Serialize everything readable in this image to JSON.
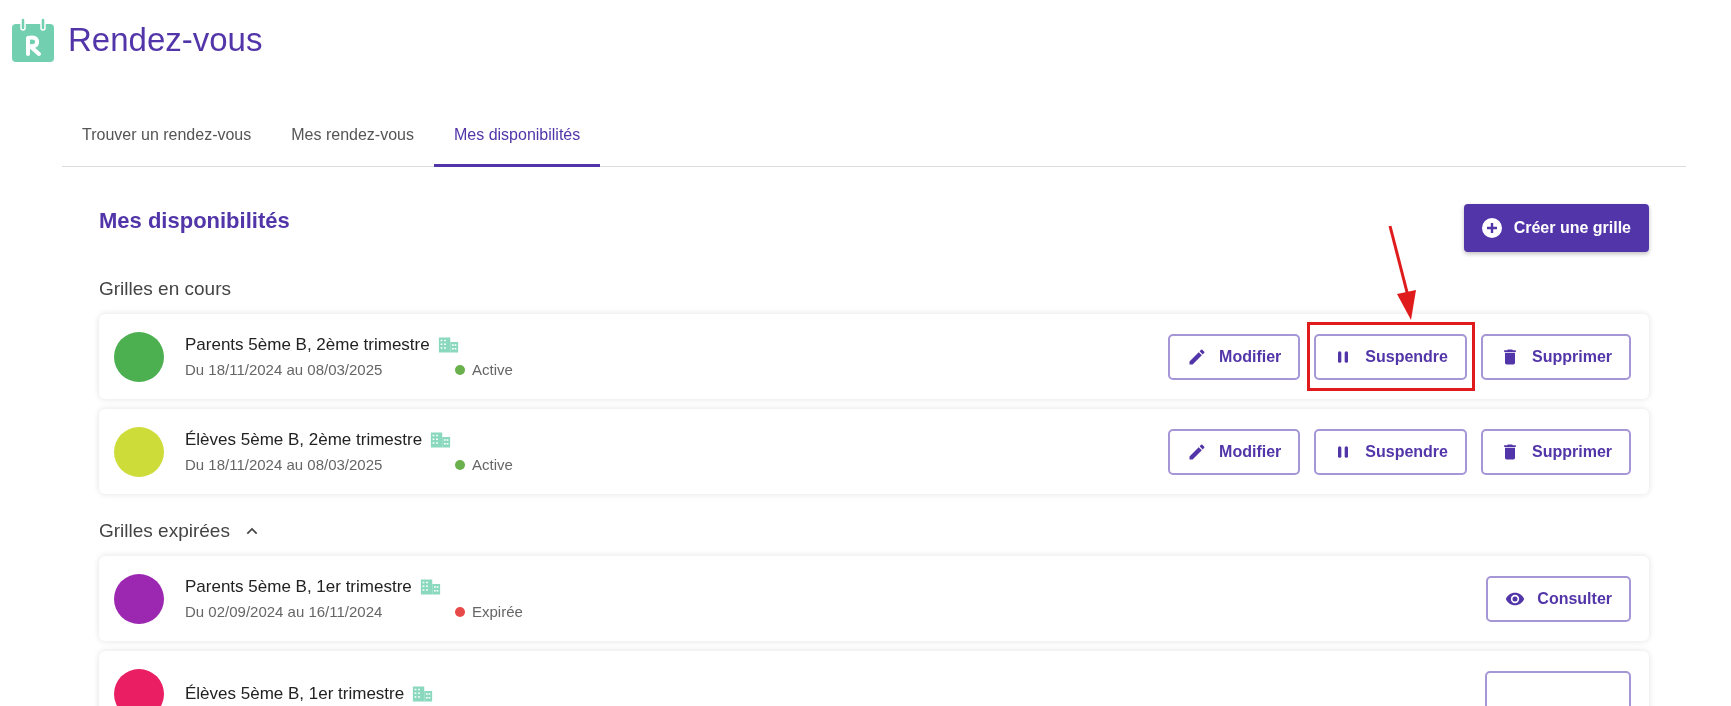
{
  "app": {
    "title": "Rendez-vous"
  },
  "tabs": [
    {
      "label": "Trouver un rendez-vous",
      "selected": false
    },
    {
      "label": "Mes rendez-vous",
      "selected": false
    },
    {
      "label": "Mes disponibilités",
      "selected": true
    }
  ],
  "page": {
    "title": "Mes disponibilités",
    "create_button": "Créer une grille"
  },
  "sections": [
    {
      "title": "Grilles en cours",
      "grids": [
        {
          "name": "Parents 5ème B, 2ème trimestre",
          "color": "#4caf50",
          "dates": "Du 18/11/2024 au 08/03/2025",
          "status": {
            "label": "Active",
            "color": "#6ab04c"
          },
          "actions": [
            {
              "kind": "edit",
              "label": "Modifier",
              "highlighted": false
            },
            {
              "kind": "pause",
              "label": "Suspendre",
              "highlighted": true
            },
            {
              "kind": "delete",
              "label": "Supprimer",
              "highlighted": false
            }
          ]
        },
        {
          "name": "Élèves 5ème B, 2ème trimestre",
          "color": "#cddc39",
          "dates": "Du 18/11/2024 au 08/03/2025",
          "status": {
            "label": "Active",
            "color": "#6ab04c"
          },
          "actions": [
            {
              "kind": "edit",
              "label": "Modifier",
              "highlighted": false
            },
            {
              "kind": "pause",
              "label": "Suspendre",
              "highlighted": false
            },
            {
              "kind": "delete",
              "label": "Supprimer",
              "highlighted": false
            }
          ]
        }
      ]
    },
    {
      "title": "Grilles expirées",
      "expanded": true,
      "grids": [
        {
          "name": "Parents 5ème B, 1er trimestre",
          "color": "#9c27b0",
          "dates": "Du 02/09/2024 au 16/11/2024",
          "status": {
            "label": "Expirée",
            "color": "#e84a4a"
          },
          "actions": [
            {
              "kind": "view",
              "label": "Consulter",
              "highlighted": false
            }
          ]
        },
        {
          "name": "Élèves 5ème B, 1er trimestre",
          "color": "#e91e63",
          "actions": [
            {
              "kind": "cut",
              "highlighted": false
            }
          ]
        }
      ]
    }
  ]
}
